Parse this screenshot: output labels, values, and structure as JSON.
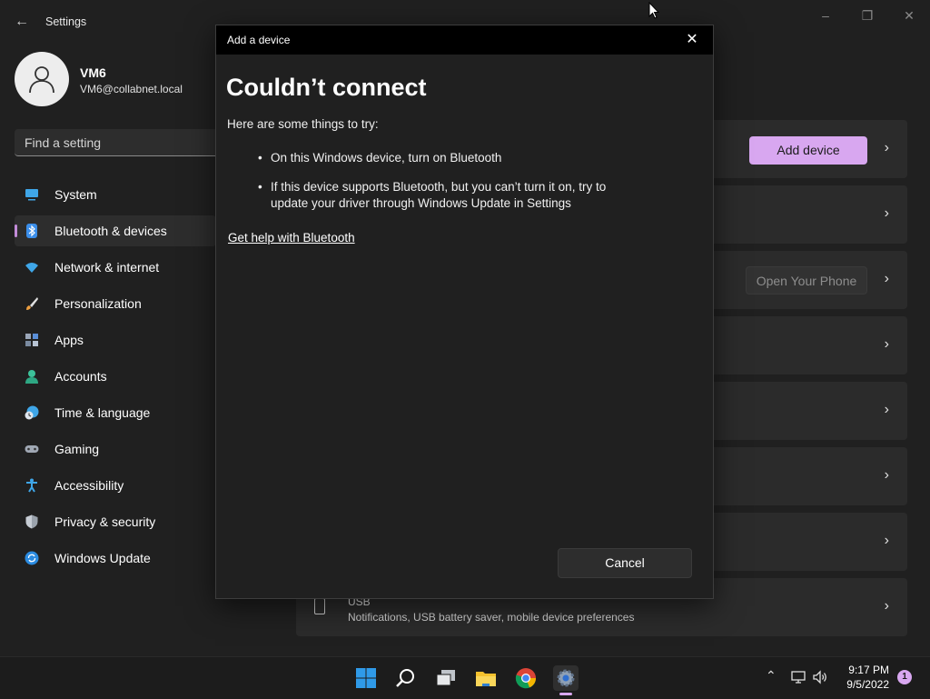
{
  "window": {
    "app_title": "Settings"
  },
  "profile": {
    "name": "VM6",
    "email": "VM6@collabnet.local"
  },
  "search": {
    "placeholder": "Find a setting"
  },
  "sidebar": {
    "items": [
      {
        "label": "System",
        "icon": "system-icon"
      },
      {
        "label": "Bluetooth & devices",
        "icon": "bluetooth-icon",
        "active": true
      },
      {
        "label": "Network & internet",
        "icon": "wifi-icon"
      },
      {
        "label": "Personalization",
        "icon": "brush-icon"
      },
      {
        "label": "Apps",
        "icon": "apps-icon"
      },
      {
        "label": "Accounts",
        "icon": "accounts-icon"
      },
      {
        "label": "Time & language",
        "icon": "clock-globe-icon"
      },
      {
        "label": "Gaming",
        "icon": "gamepad-icon"
      },
      {
        "label": "Accessibility",
        "icon": "accessibility-icon"
      },
      {
        "label": "Privacy & security",
        "icon": "shield-icon"
      },
      {
        "label": "Windows Update",
        "icon": "update-icon"
      }
    ]
  },
  "main": {
    "add_device_label": "Add device",
    "open_phone_label": "Open Your Phone",
    "usb": {
      "title": "USB",
      "description": "Notifications, USB battery saver, mobile device preferences"
    }
  },
  "dialog": {
    "title": "Add a device",
    "heading": "Couldn’t connect",
    "intro": "Here are some things to try:",
    "tips": [
      "On this Windows device, turn on Bluetooth",
      "If this device supports Bluetooth, but you can’t turn it on, try to update your driver through Windows Update in Settings"
    ],
    "help_link": "Get help with Bluetooth",
    "cancel_label": "Cancel"
  },
  "taskbar": {
    "time": "9:17 PM",
    "date": "9/5/2022",
    "notification_count": "1"
  },
  "colors": {
    "accent": "#d8a7f0",
    "background": "#202020",
    "card": "#2b2b2b",
    "dialog_titlebar": "#000000"
  }
}
